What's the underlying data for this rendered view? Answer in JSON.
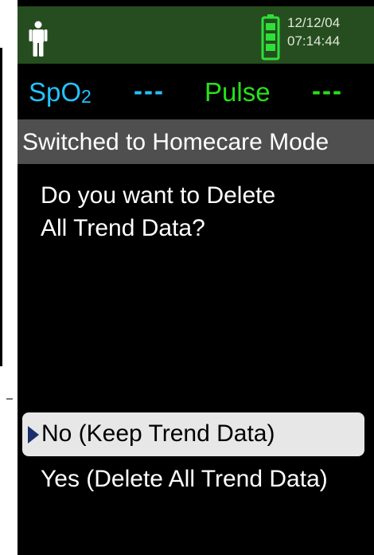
{
  "header": {
    "date": "12/12/04",
    "time": "07:14:44",
    "icons": [
      "person-icon",
      "battery-icon"
    ]
  },
  "vitals": {
    "spo2_label": "SpO",
    "spo2_subscript": "2",
    "spo2_value": "---",
    "pulse_label": "Pulse",
    "pulse_value": "---"
  },
  "status": {
    "message": "Switched to Homecare Mode"
  },
  "prompt": {
    "line1": "Do you want to Delete",
    "line2": "All Trend Data?"
  },
  "options": {
    "no_label": "No   (Keep Trend Data)",
    "yes_label": "Yes (Delete All Trend Data)"
  },
  "colors": {
    "header_bg": "#264d1f",
    "spo2": "#23c3ff",
    "pulse": "#28e01a",
    "battery": "#2fe03a",
    "status_bg": "#4f4f4f",
    "selected_bg": "#e7e7e7",
    "selection_arrow": "#1a2f6b"
  }
}
